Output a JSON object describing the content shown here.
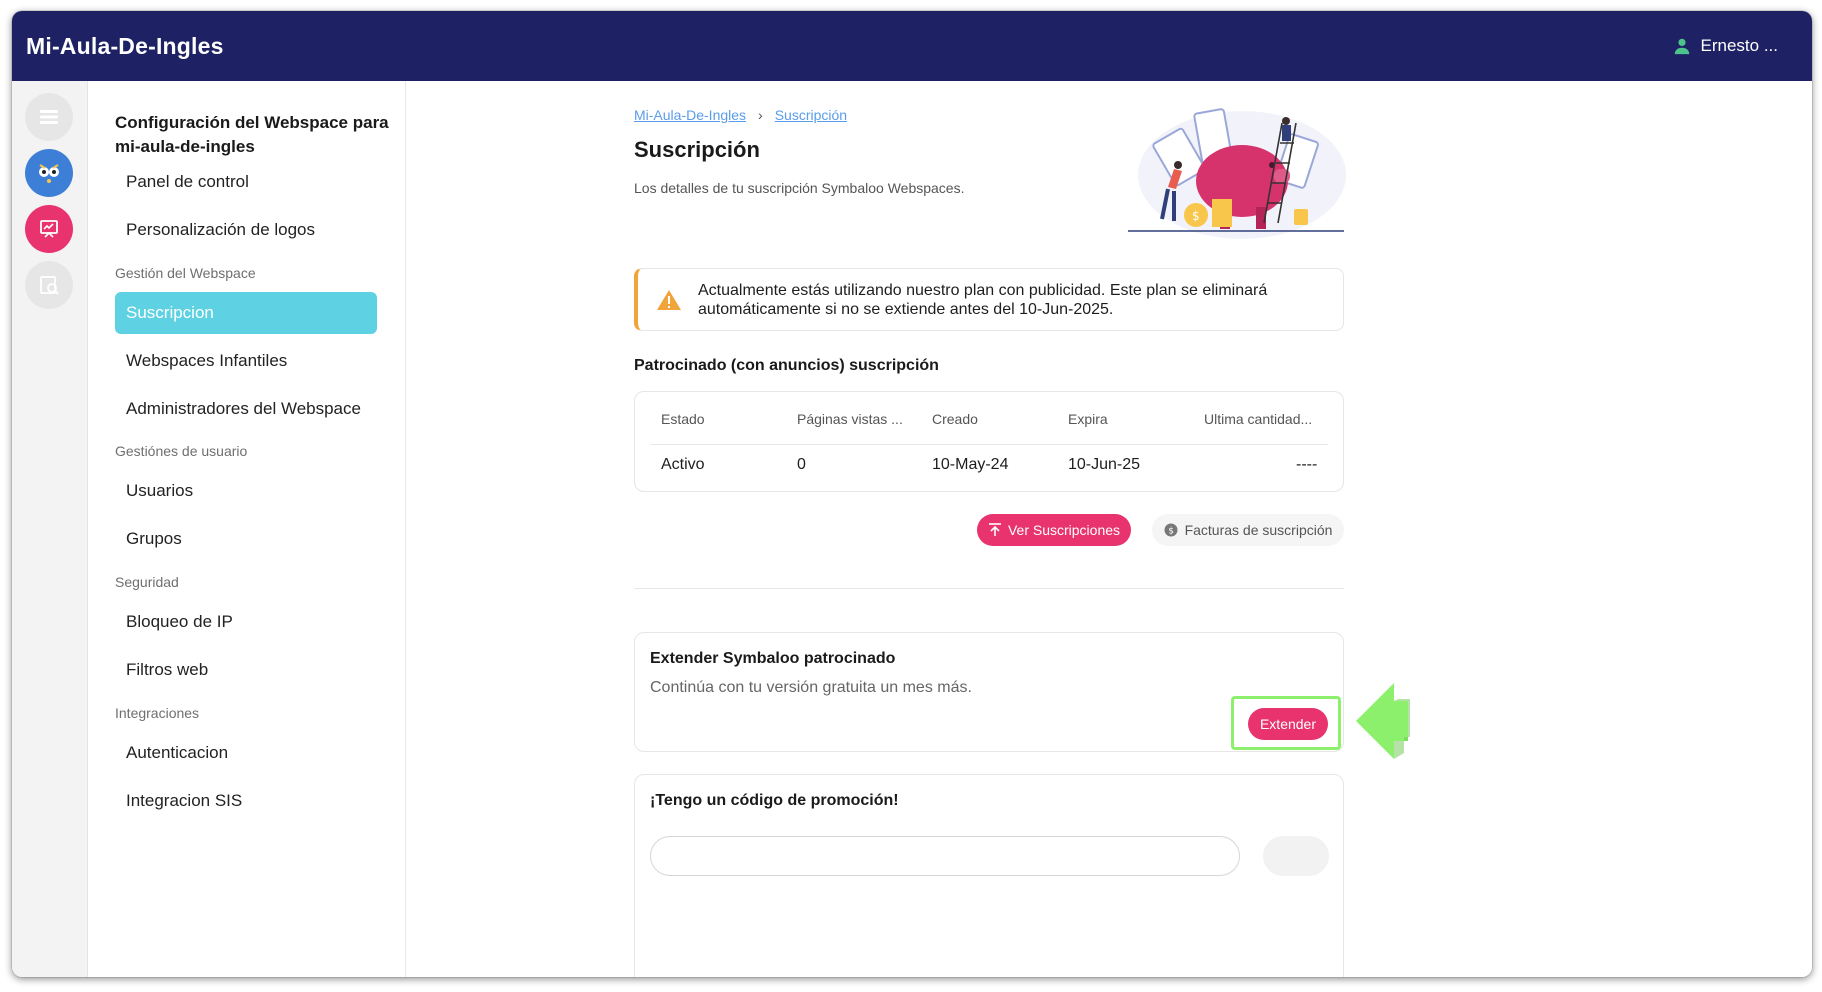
{
  "topbar": {
    "title": "Mi-Aula-De-Ingles",
    "user_name": "Ernesto ..."
  },
  "settings": {
    "heading": "Configuración del Webspace para mi-aula-de-ingles",
    "items": [
      {
        "label": "Panel de control"
      },
      {
        "label": "Personalización de logos"
      },
      {
        "section": "Gestión del Webspace"
      },
      {
        "label": "Suscripcion",
        "active": true
      },
      {
        "label": "Webspaces Infantiles"
      },
      {
        "label": "Administradores del Webspace"
      },
      {
        "section": "Gestiónes de usuario"
      },
      {
        "label": "Usuarios"
      },
      {
        "label": "Grupos"
      },
      {
        "section": "Seguridad"
      },
      {
        "label": "Bloqueo de IP"
      },
      {
        "label": "Filtros web"
      },
      {
        "section": "Integraciones"
      },
      {
        "label": "Autenticacion"
      },
      {
        "label": "Integracion SIS"
      }
    ]
  },
  "breadcrumb": {
    "root": "Mi-Aula-De-Ingles",
    "separator": "›",
    "current": "Suscripción"
  },
  "page": {
    "title": "Suscripción",
    "description": "Los detalles de tu suscripción Symbaloo Webspaces."
  },
  "alert": {
    "text": "Actualmente estás utilizando nuestro plan con publicidad. Este plan se eliminará automáticamente si no se extiende antes del 10-Jun-2025."
  },
  "subscription": {
    "title": "Patrocinado (con anuncios) suscripción",
    "columns": [
      "Estado",
      "Páginas vistas ...",
      "Creado",
      "Expira",
      "Ultima cantidad..."
    ],
    "row": [
      "Activo",
      "0",
      "10-May-24",
      "10-Jun-25",
      "----"
    ]
  },
  "actions": {
    "view_subscriptions": "Ver Suscripciones",
    "invoices": "Facturas de suscripción"
  },
  "extend": {
    "title": "Extender Symbaloo patrocinado",
    "description": "Continúa con tu versión gratuita un mes más.",
    "button": "Extender"
  },
  "promo": {
    "title": "¡Tengo un código de promoción!"
  },
  "colors": {
    "topbar": "#1e2265",
    "accent_pink": "#e8336f",
    "active_nav": "#5ed2e2",
    "warning": "#f0a43a",
    "highlight": "#8cf06c"
  }
}
